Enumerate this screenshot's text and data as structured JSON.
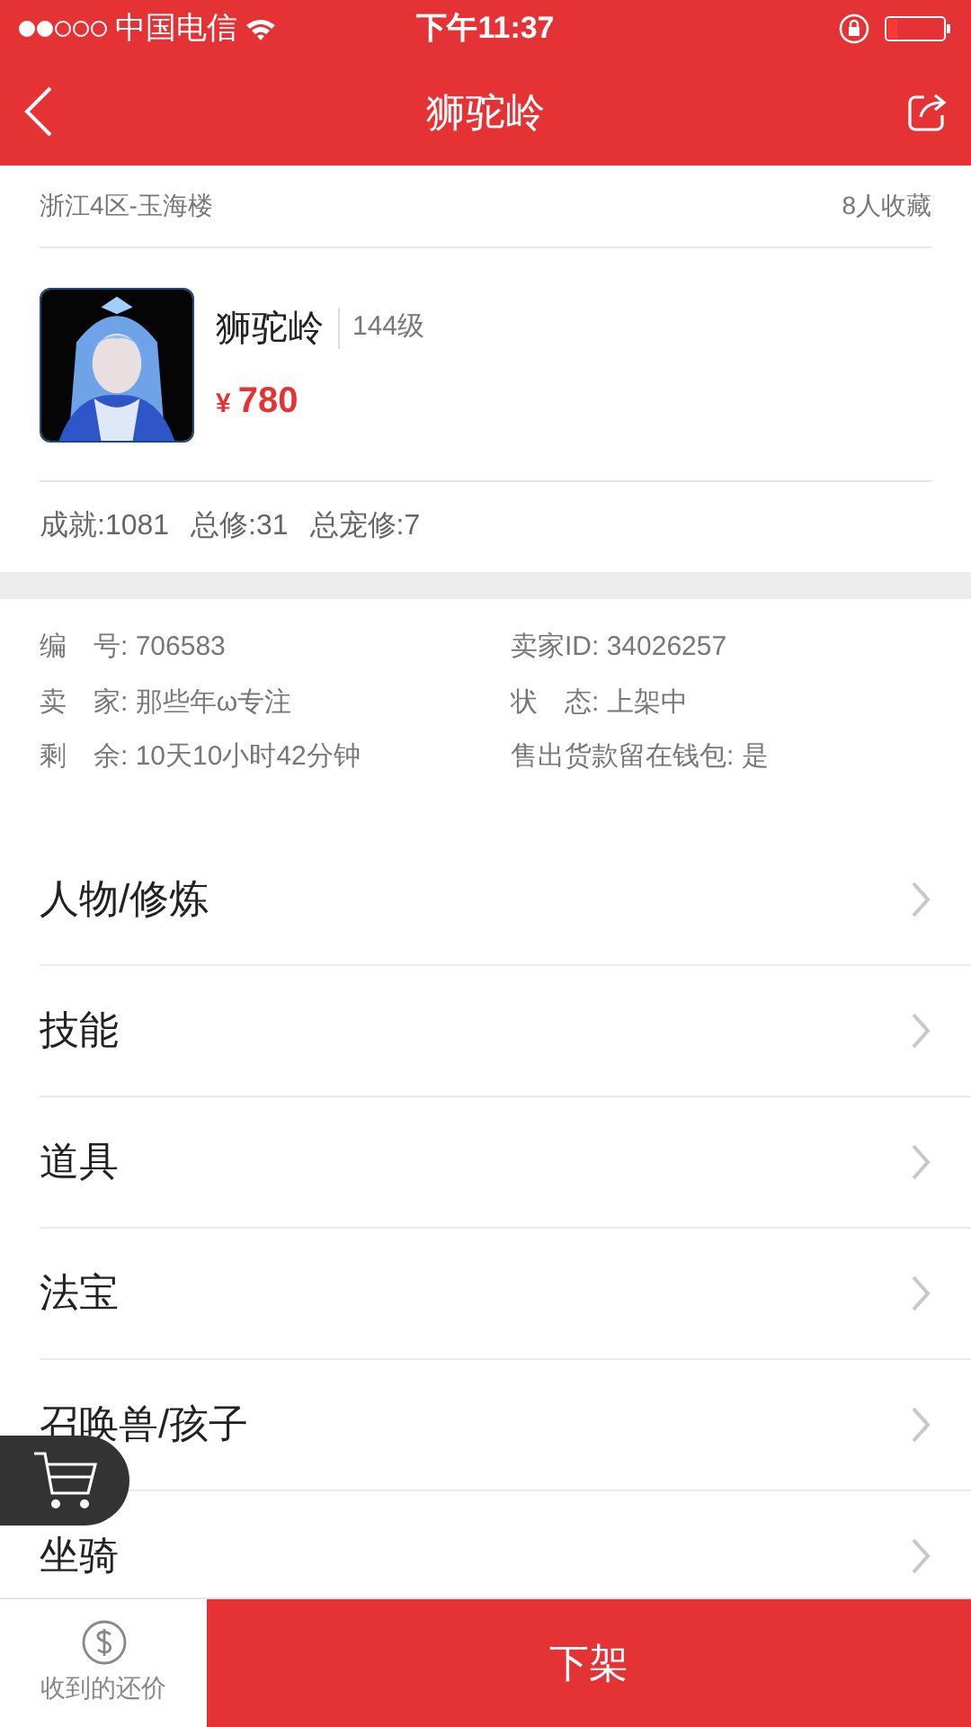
{
  "status_bar": {
    "carrier": "中国电信",
    "time": "下午11:37"
  },
  "nav": {
    "title": "狮驼岭"
  },
  "server": {
    "name": "浙江4区-玉海楼",
    "favorites": "8人收藏"
  },
  "character": {
    "name": "狮驼岭",
    "level": "144级",
    "currency": "¥",
    "price": "780"
  },
  "stats": [
    "成就:1081",
    "总修:31",
    "总宠修:7"
  ],
  "info": [
    {
      "label": "编　号:",
      "value": "706583"
    },
    {
      "label": "卖家ID:",
      "value": "34026257"
    },
    {
      "label": "卖　家:",
      "value": "那些年ω专注"
    },
    {
      "label": "状　态:",
      "value": "上架中"
    },
    {
      "label": "剩　余:",
      "value": "10天10小时42分钟"
    },
    {
      "label": "售出货款留在钱包:",
      "value": "是"
    }
  ],
  "menu": [
    {
      "label": "人物/修炼"
    },
    {
      "label": "技能"
    },
    {
      "label": "道具"
    },
    {
      "label": "法宝"
    },
    {
      "label": "召唤兽/孩子"
    },
    {
      "label": "坐骑"
    }
  ],
  "bottom_bar": {
    "offers_label": "收到的还价",
    "primary_button": "下架"
  }
}
